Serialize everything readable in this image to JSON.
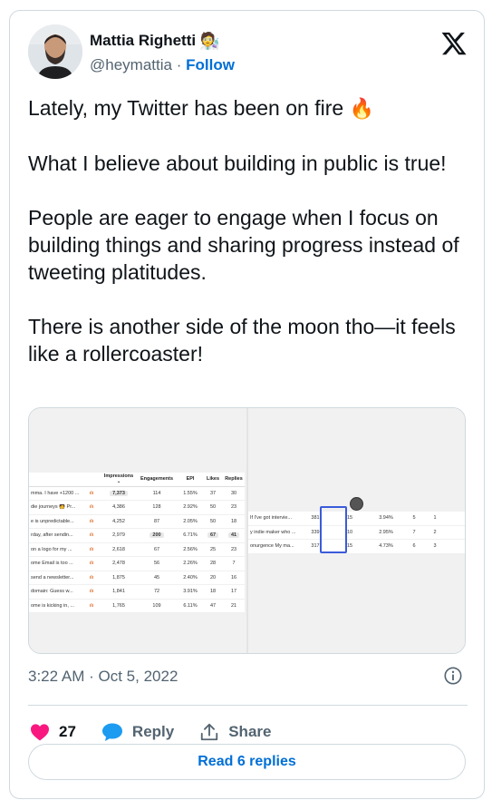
{
  "author": {
    "name": "Mattia Righetti",
    "name_emoji": "🧑‍🔬",
    "handle": "@heymattia",
    "separator": "·",
    "follow_label": "Follow"
  },
  "tweet": {
    "line1": "Lately, my Twitter has been on fire",
    "line1_emoji": "🔥",
    "para2": "What I believe about building in public is true!",
    "para3": "People are eager to engage when I focus on building things and sharing progress instead of tweeting platitudes.",
    "para4": "There is another side of the moon tho—it feels like a rollercoaster!"
  },
  "media": {
    "left_table": {
      "headers": [
        "Impressions ⌄",
        "Engagements",
        "EPI",
        "Likes",
        "Replies"
      ],
      "rows": [
        {
          "tweet": "mma. I have +1200 ...",
          "impressions": "7,373",
          "engagements": "114",
          "epi": "1.55%",
          "likes": "37",
          "replies": "30"
        },
        {
          "tweet": "die journeys 🧑 Pr...",
          "impressions": "4,386",
          "engagements": "128",
          "epi": "2.92%",
          "likes": "50",
          "replies": "23"
        },
        {
          "tweet": "e is unpredictable...",
          "impressions": "4,252",
          "engagements": "87",
          "epi": "2.05%",
          "likes": "50",
          "replies": "18"
        },
        {
          "tweet": "rday, after sendin...",
          "impressions": "2,979",
          "engagements": "200",
          "epi": "6.71%",
          "likes": "67",
          "replies": "41"
        },
        {
          "tweet": "on a logo for my ...",
          "impressions": "2,618",
          "engagements": "67",
          "epi": "2.56%",
          "likes": "25",
          "replies": "23"
        },
        {
          "tweet": "ome Email is too ...",
          "impressions": "2,478",
          "engagements": "56",
          "epi": "2.26%",
          "likes": "28",
          "replies": "7"
        },
        {
          "tweet": "send a newsletter...",
          "impressions": "1,875",
          "engagements": "45",
          "epi": "2.40%",
          "likes": "20",
          "replies": "16"
        },
        {
          "tweet": "domain: Guess w...",
          "impressions": "1,841",
          "engagements": "72",
          "epi": "3.91%",
          "likes": "18",
          "replies": "17"
        },
        {
          "tweet": "ome is kicking in, ...",
          "impressions": "1,765",
          "engagements": "109",
          "epi": "6.11%",
          "likes": "47",
          "replies": "21"
        }
      ]
    },
    "right_table": {
      "rows": [
        {
          "tweet": "If I've got intervie...",
          "impressions": "381",
          "engagements": "15",
          "epi": "3.94%",
          "likes": "5",
          "replies": "1"
        },
        {
          "tweet": "y indie maker who ...",
          "impressions": "339",
          "engagements": "10",
          "epi": "2.95%",
          "likes": "7",
          "replies": "2"
        },
        {
          "tweet": "onurgence My ma...",
          "impressions": "317",
          "engagements": "15",
          "epi": "4.73%",
          "likes": "6",
          "replies": "3"
        }
      ]
    }
  },
  "meta": {
    "time": "3:22 AM",
    "separator": "·",
    "date": "Oct 5, 2022"
  },
  "actions": {
    "like_count": "27",
    "reply_label": "Reply",
    "share_label": "Share"
  },
  "read_replies_label": "Read 6 replies",
  "colors": {
    "link_blue": "#006fd6",
    "heart_pink": "#f91880",
    "text_gray": "#536471",
    "highlight_box": "#3b5bdb"
  }
}
